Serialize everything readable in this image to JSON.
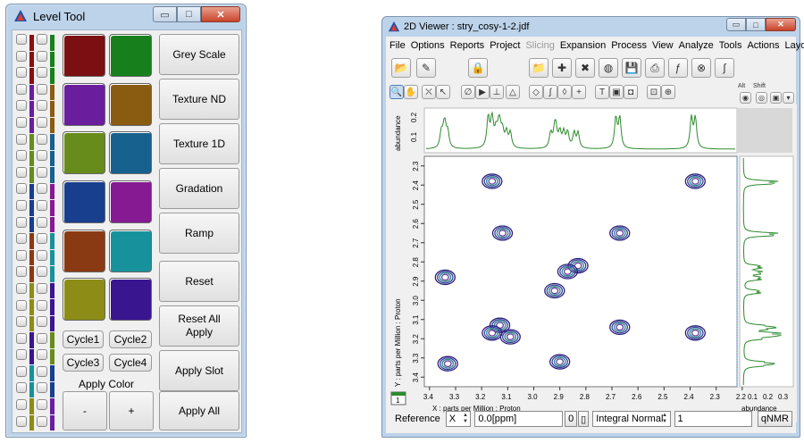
{
  "level_tool": {
    "title": "Level Tool",
    "window_buttons": {
      "minimize": "▭",
      "maximize": "□",
      "close": "✕"
    },
    "swatch_colors": [
      [
        "#7b0f12",
        "#17801d"
      ],
      [
        "#6a1e9e",
        "#8a5c12"
      ],
      [
        "#678c1b",
        "#17618e"
      ],
      [
        "#173f8e",
        "#851a92"
      ],
      [
        "#8a3a12",
        "#17929c"
      ],
      [
        "#8c8c17",
        "#3a1590"
      ]
    ],
    "stripe_colors_a": [
      "#8b0f10",
      "#8b0f10",
      "#8b0f10",
      "#6a1e9e",
      "#6a1e9e",
      "#6a1e9e",
      "#678c1b",
      "#678c1b",
      "#678c1b",
      "#173f8e",
      "#173f8e",
      "#173f8e",
      "#8a3a12",
      "#8a3a12",
      "#8a3a12",
      "#8c8c17",
      "#8c8c17",
      "#8c8c17",
      "#3a1590",
      "#3a1590",
      "#17929c",
      "#17929c",
      "#8c8c17",
      "#8c8c17"
    ],
    "stripe_colors_b": [
      "#17801d",
      "#17801d",
      "#17801d",
      "#8a5c12",
      "#8a5c12",
      "#8a5c12",
      "#17618e",
      "#17618e",
      "#17618e",
      "#851a92",
      "#851a92",
      "#851a92",
      "#17929c",
      "#17929c",
      "#17929c",
      "#3a1590",
      "#3a1590",
      "#3a1590",
      "#678c1b",
      "#678c1b",
      "#173f8e",
      "#173f8e",
      "#6a1e9e",
      "#6a1e9e"
    ],
    "side_buttons": [
      "Grey Scale",
      "Texture ND",
      "Texture 1D",
      "Gradation",
      "Ramp",
      "Reset",
      "Reset All\nApply",
      "Apply Slot",
      "Apply All"
    ],
    "cycle_buttons": [
      "Cycle1",
      "Cycle2",
      "Cycle3",
      "Cycle4"
    ],
    "apply_color_label": "Apply Color",
    "minus_label": "-",
    "plus_label": "+"
  },
  "viewer": {
    "title": "2D Viewer : stry_cosy-1-2.jdf",
    "window_buttons": {
      "minimize": "▭",
      "maximize": "□",
      "close": "✕"
    },
    "menu": [
      "File",
      "Options",
      "Reports",
      "Project",
      "Slicing",
      "Expansion",
      "Process",
      "View",
      "Analyze",
      "Tools",
      "Actions",
      "Layout"
    ],
    "disabled_menu": "Slicing",
    "toolbar_icons_row1": [
      "open-folder-icon",
      "brush-icon",
      "lock-icon",
      "folder-icon",
      "add-icon",
      "remove-icon",
      "cylinder-icon",
      "save-icon",
      "print-icon",
      "script-icon",
      "cancel-icon",
      "integral-icon"
    ],
    "toolbar_glyphs_row1": [
      "📂",
      "✎",
      "🔒",
      "📁",
      "✚",
      "✖",
      "◍",
      "💾",
      "⎙",
      "ƒ",
      "⊗",
      "∫"
    ],
    "toolbar_icons_row2": [
      "zoom-icon",
      "hand-icon",
      "cursor-icon",
      "select-icon",
      "phase-icon",
      "pointer-icon",
      "peak-icon",
      "triangle-icon",
      "diamond-icon",
      "integral-small-icon",
      "eraser-icon",
      "plus-icon",
      "text-icon",
      "box-icon",
      "frame-icon",
      "zoom-fit-icon",
      "crosshair-icon"
    ],
    "toolbar_glyphs_row2": [
      "🔍",
      "✋",
      "⛌",
      "↖",
      "∅",
      "▶",
      "⊥",
      "△",
      "◇",
      "∫",
      "◊",
      "+",
      "T",
      "▣",
      "◘",
      "⊡",
      "⊕"
    ],
    "alt_label": "Alt",
    "shift_label": "Shift",
    "top_axis_label": "abundance",
    "top_ticks": [
      "0.2",
      "0.1"
    ],
    "x_axis_title": "X : parts per Million : Proton",
    "y_axis_title": "Y : parts per Million : Proton",
    "right_axis_title": "abundance",
    "corner_label": "1",
    "status": {
      "reference_label": "Reference",
      "axis_value": "X",
      "ppm_value": "0.0[ppm]",
      "offset_value": "0",
      "mode_value": "Integral Normal",
      "count_value": "1",
      "qnmr_label": "qNMR"
    }
  },
  "chart_data": {
    "type": "contour",
    "xlabel": "X : parts per Million : Proton",
    "ylabel": "Y : parts per Million : Proton",
    "x_ticks": [
      "3.4",
      "3.3",
      "3.2",
      "3.1",
      "3.0",
      "2.9",
      "2.8",
      "2.7",
      "2.6",
      "2.5",
      "2.4",
      "2.3",
      "2.2"
    ],
    "y_ticks": [
      "2.3",
      "2.4",
      "2.5",
      "2.6",
      "2.7",
      "2.8",
      "2.9",
      "3.0",
      "3.1",
      "3.2",
      "3.3",
      "3.4"
    ],
    "right_ticks": [
      "0.1",
      "0.2",
      "0.3"
    ],
    "x_range": [
      3.42,
      2.22
    ],
    "y_range": [
      2.25,
      3.45
    ],
    "peaks": [
      {
        "x": 3.16,
        "y": 2.38
      },
      {
        "x": 2.38,
        "y": 2.38
      },
      {
        "x": 3.12,
        "y": 2.65
      },
      {
        "x": 2.67,
        "y": 2.65
      },
      {
        "x": 2.83,
        "y": 2.82
      },
      {
        "x": 2.87,
        "y": 2.85
      },
      {
        "x": 3.34,
        "y": 2.88
      },
      {
        "x": 2.92,
        "y": 2.95
      },
      {
        "x": 3.13,
        "y": 3.13
      },
      {
        "x": 3.16,
        "y": 3.17
      },
      {
        "x": 3.09,
        "y": 3.19
      },
      {
        "x": 2.67,
        "y": 3.14
      },
      {
        "x": 2.38,
        "y": 3.17
      },
      {
        "x": 3.33,
        "y": 3.33
      },
      {
        "x": 2.9,
        "y": 3.32
      }
    ]
  }
}
